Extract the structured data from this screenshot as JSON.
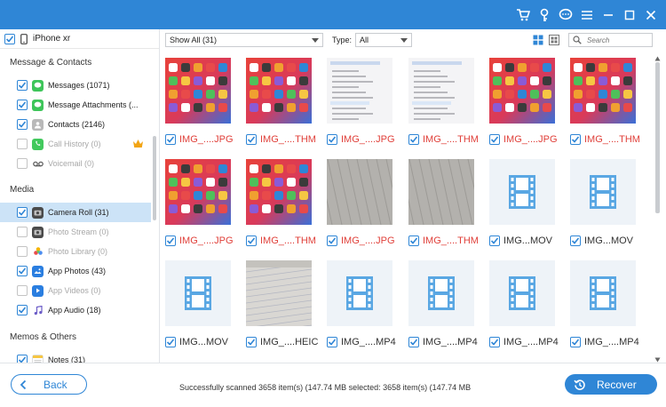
{
  "title_bar": {
    "icons": [
      "cart-icon",
      "key-icon",
      "chat-icon",
      "menu-icon",
      "minimize-icon",
      "maximize-icon",
      "close-icon"
    ]
  },
  "sidebar": {
    "device": "iPhone xr",
    "sections": {
      "message_contacts": "Message & Contacts",
      "media": "Media",
      "memos_others": "Memos & Others"
    },
    "items": [
      {
        "label": "Messages (1071)",
        "checked": true,
        "disabled": false,
        "icon": "messages-icon"
      },
      {
        "label": "Message Attachments (...",
        "checked": true,
        "disabled": false,
        "icon": "attachments-icon"
      },
      {
        "label": "Contacts (2146)",
        "checked": true,
        "disabled": false,
        "icon": "contacts-icon"
      },
      {
        "label": "Call History (0)",
        "checked": false,
        "disabled": true,
        "icon": "phone-icon"
      },
      {
        "label": "Voicemail (0)",
        "checked": false,
        "disabled": true,
        "icon": "voicemail-icon"
      },
      {
        "label": "Camera Roll (31)",
        "checked": true,
        "disabled": false,
        "icon": "camera-icon"
      },
      {
        "label": "Photo Stream (0)",
        "checked": false,
        "disabled": true,
        "icon": "photo-stream-icon"
      },
      {
        "label": "Photo Library (0)",
        "checked": false,
        "disabled": true,
        "icon": "photo-library-icon"
      },
      {
        "label": "App Photos (43)",
        "checked": true,
        "disabled": false,
        "icon": "app-photos-icon"
      },
      {
        "label": "App Videos (0)",
        "checked": false,
        "disabled": true,
        "icon": "app-videos-icon"
      },
      {
        "label": "App Audio (18)",
        "checked": true,
        "disabled": false,
        "icon": "music-icon"
      },
      {
        "label": "Notes (31)",
        "checked": true,
        "disabled": false,
        "icon": "notes-icon"
      }
    ]
  },
  "toolbar": {
    "show_value": "Show All (31)",
    "type_label": "Type:",
    "type_value": "All",
    "search_placeholder": "Search"
  },
  "grid": {
    "rows": [
      [
        {
          "name": "IMG_....JPG",
          "thumb": "homescreen",
          "red": true
        },
        {
          "name": "IMG_....THM",
          "thumb": "homescreen",
          "red": true
        },
        {
          "name": "IMG_....JPG",
          "thumb": "settings",
          "red": true
        },
        {
          "name": "IMG_....THM",
          "thumb": "settings",
          "red": true
        },
        {
          "name": "IMG_....JPG",
          "thumb": "homescreen",
          "red": true
        },
        {
          "name": "IMG_....THM",
          "thumb": "homescreen",
          "red": true
        }
      ],
      [
        {
          "name": "IMG_....JPG",
          "thumb": "homescreen",
          "red": true
        },
        {
          "name": "IMG_....THM",
          "thumb": "homescreen",
          "red": true
        },
        {
          "name": "IMG_....JPG",
          "thumb": "paper",
          "red": true
        },
        {
          "name": "IMG_....THM",
          "thumb": "paper",
          "red": true
        },
        {
          "name": "IMG...MOV",
          "thumb": "video",
          "red": false
        },
        {
          "name": "IMG...MOV",
          "thumb": "video",
          "red": false
        }
      ],
      [
        {
          "name": "IMG...MOV",
          "thumb": "video",
          "red": false
        },
        {
          "name": "IMG_....HEIC",
          "thumb": "notebook",
          "red": false
        },
        {
          "name": "IMG_....MP4",
          "thumb": "video",
          "red": false
        },
        {
          "name": "IMG_....MP4",
          "thumb": "video",
          "red": false
        },
        {
          "name": "IMG_....MP4",
          "thumb": "video",
          "red": false
        },
        {
          "name": "IMG_....MP4",
          "thumb": "video",
          "red": false
        }
      ]
    ]
  },
  "footer": {
    "back_label": "Back",
    "status": "Successfully scanned 3658 item(s) (147.74 MB    selected: 3658 item(s) (147.74 MB",
    "recover_label": "Recover"
  },
  "colors": {
    "accent": "#2f86d6",
    "selected_bg": "#cce3f7",
    "red_text": "#e0403a",
    "video_icon": "#5aa7e3"
  }
}
